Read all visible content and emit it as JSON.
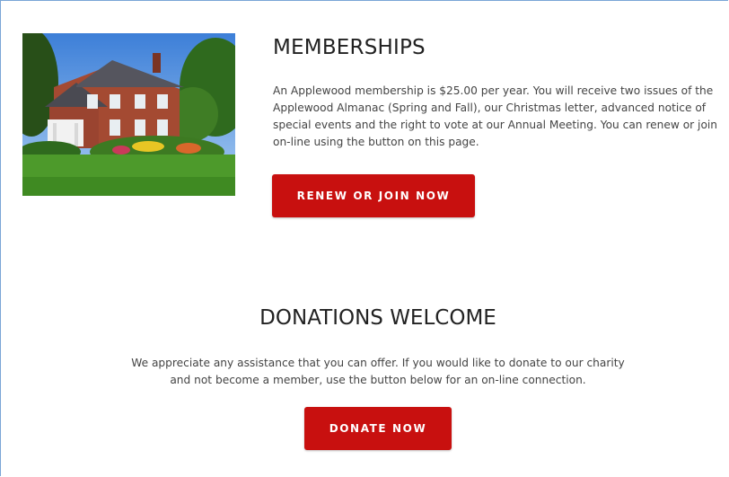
{
  "memberships": {
    "title": "MEMBERSHIPS",
    "text": "An Applewood membership is $25.00 per year.  You will receive two issues of the Applewood Almanac (Spring and Fall), our Christmas letter, advanced notice of special events and the right to vote at our Annual Meeting.  You can renew or join on-line using the button on this page.",
    "button_label": "RENEW OR JOIN NOW",
    "photo_icon": "house-photo"
  },
  "donations": {
    "title": "DONATIONS WELCOME",
    "text": "We appreciate any assistance that you can offer.  If you would like to donate to our charity and not become a member, use the button below for an on-line connection.",
    "button_label": "DONATE NOW"
  },
  "colors": {
    "accent": "#c8100f",
    "frame_border": "#7aa6d6"
  }
}
